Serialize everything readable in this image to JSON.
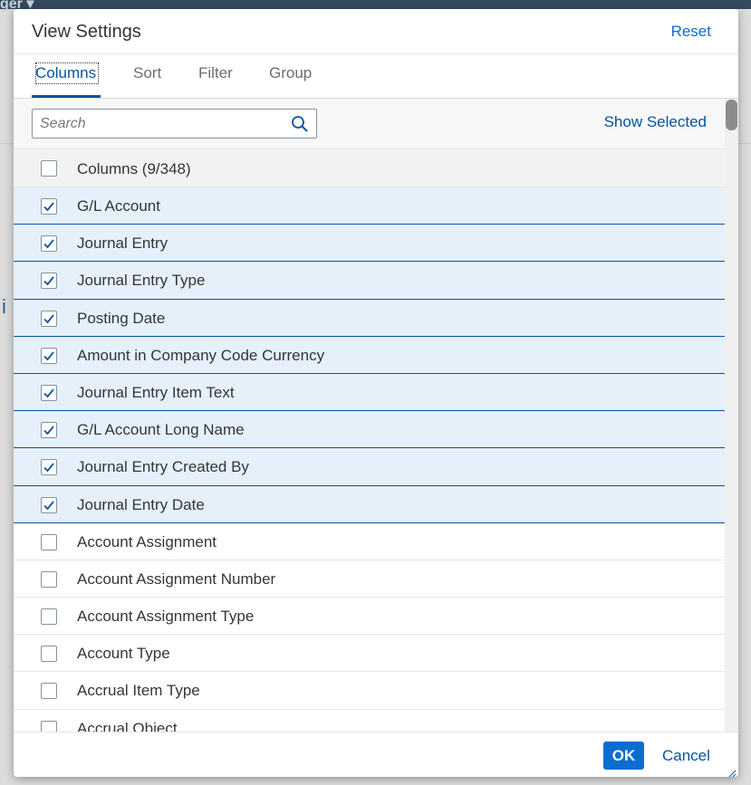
{
  "background": {
    "header_fragment": "ger ▾"
  },
  "dialog": {
    "title": "View Settings",
    "reset_label": "Reset",
    "tabs": [
      {
        "label": "Columns",
        "active": true
      },
      {
        "label": "Sort",
        "active": false
      },
      {
        "label": "Filter",
        "active": false
      },
      {
        "label": "Group",
        "active": false
      }
    ],
    "search": {
      "placeholder": "Search",
      "value": ""
    },
    "show_selected_label": "Show Selected",
    "select_all_label": "Columns (9/348)",
    "columns": [
      {
        "label": "G/L Account",
        "checked": true
      },
      {
        "label": "Journal Entry",
        "checked": true
      },
      {
        "label": "Journal Entry Type",
        "checked": true
      },
      {
        "label": "Posting Date",
        "checked": true
      },
      {
        "label": "Amount in Company Code Currency",
        "checked": true
      },
      {
        "label": "Journal Entry Item Text",
        "checked": true
      },
      {
        "label": "G/L Account Long Name",
        "checked": true
      },
      {
        "label": "Journal Entry Created By",
        "checked": true
      },
      {
        "label": "Journal Entry Date",
        "checked": true
      },
      {
        "label": "Account Assignment",
        "checked": false
      },
      {
        "label": "Account Assignment Number",
        "checked": false
      },
      {
        "label": "Account Assignment Type",
        "checked": false
      },
      {
        "label": "Account Type",
        "checked": false
      },
      {
        "label": "Accrual Item Type",
        "checked": false
      },
      {
        "label": "Accrual Object",
        "checked": false
      }
    ],
    "ok_label": "OK",
    "cancel_label": "Cancel"
  },
  "colors": {
    "accent": "#0a6ed1",
    "selected_row": "#e5f0fa",
    "selected_border": "#0854a0"
  }
}
